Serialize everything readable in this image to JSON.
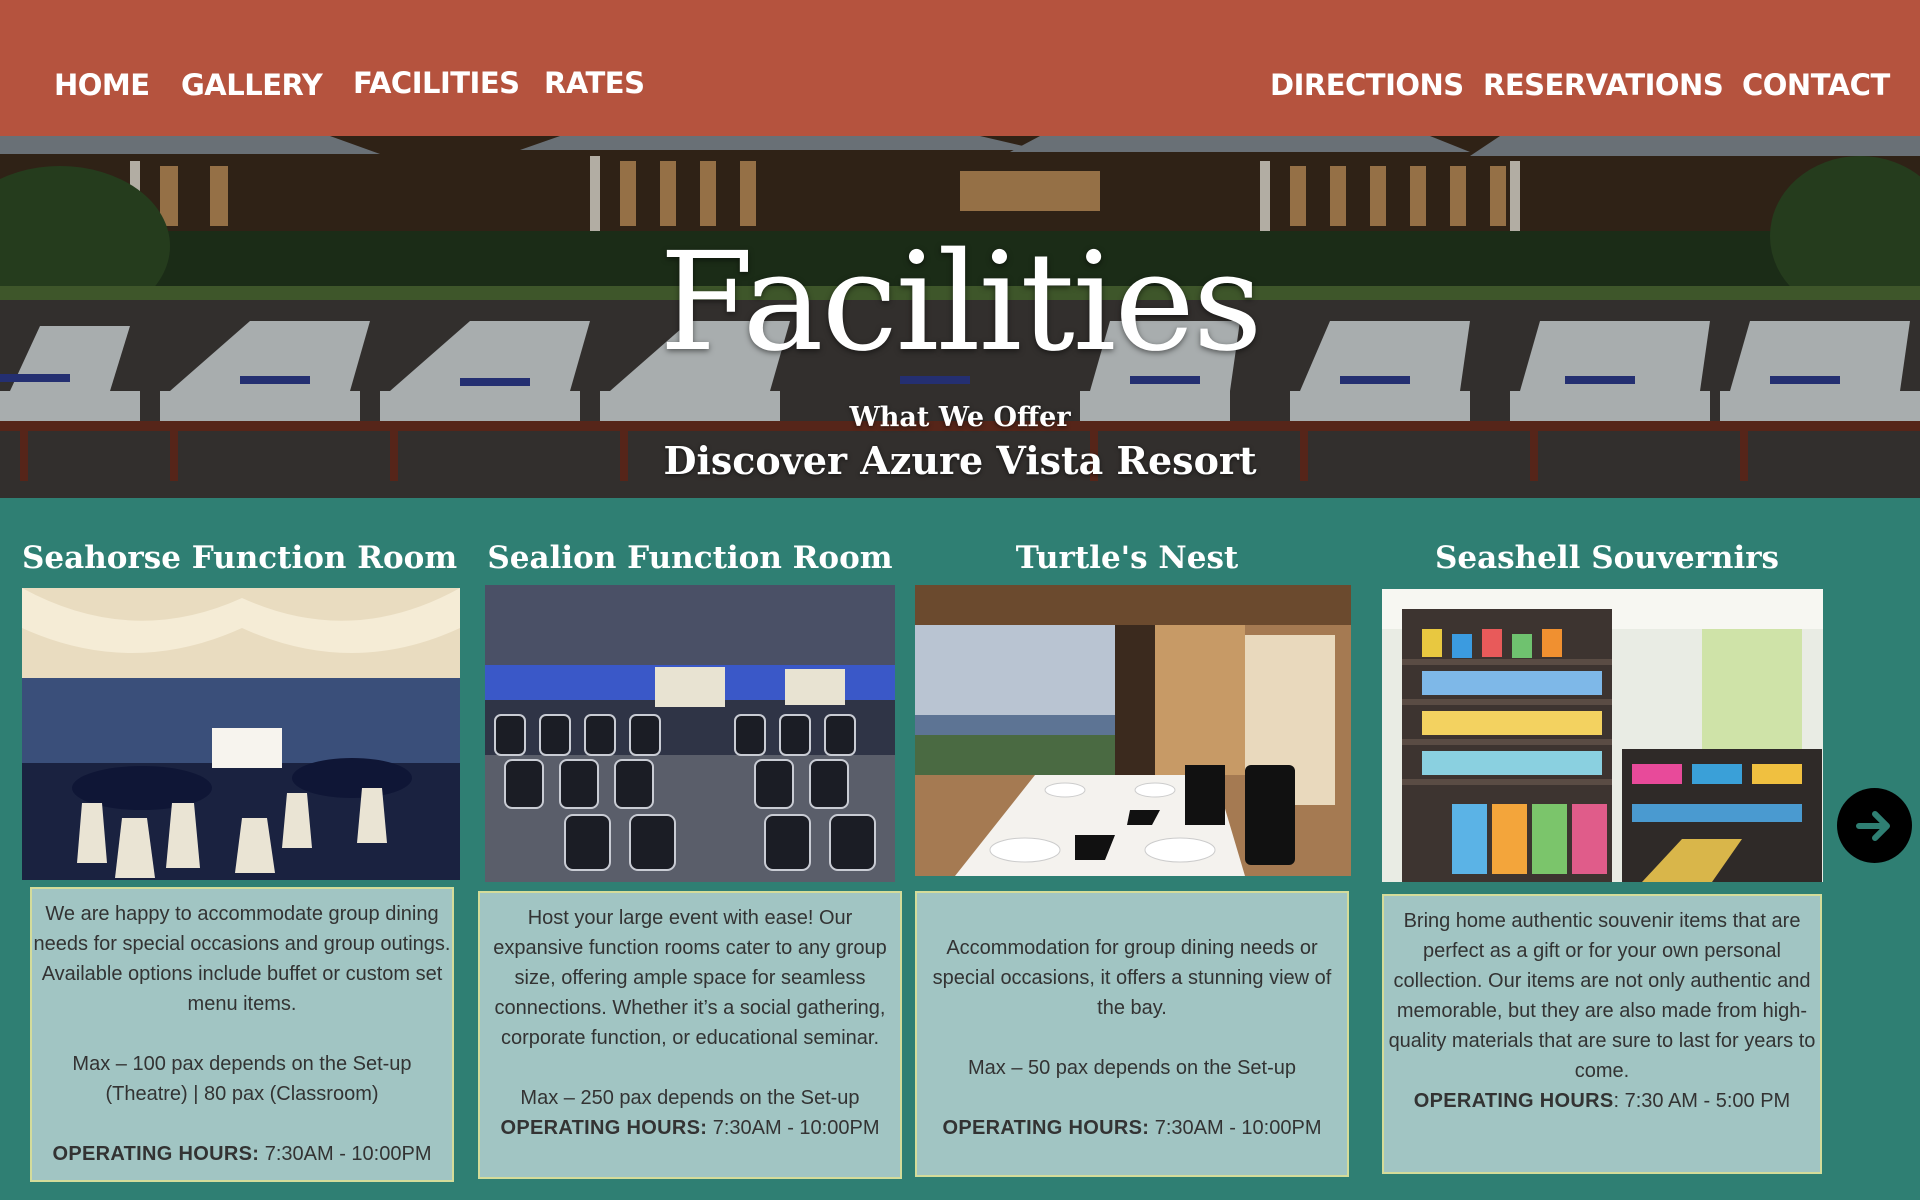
{
  "nav": {
    "left": [
      "HOME",
      "GALLERY",
      "FACILITIES",
      "RATES"
    ],
    "right": [
      "DIRECTIONS",
      "RESERVATIONS",
      "CONTACT"
    ]
  },
  "hero": {
    "title": "Facilities",
    "subtitle": "What We Offer",
    "tagline": "Discover Azure Vista Resort"
  },
  "cards": [
    {
      "title": "Seahorse Function Room",
      "desc1": "We are happy to accommodate group dining needs for special occasions and group outings. Available options include buffet or custom set menu items.",
      "desc2": "Max – 100 pax depends on the Set-up (Theatre) | 80 pax (Classroom)",
      "hours_label": "OPERATING HOURS:",
      "hours": " 7:30AM - 10:00PM"
    },
    {
      "title": "Sealion Function Room",
      "desc1": "Host your large event with ease! Our expansive function rooms cater to any group size, offering ample space for seamless connections. Whether it’s a social gathering, corporate function, or educational seminar.",
      "desc2": "Max – 250 pax depends on the Set-up",
      "hours_label": "OPERATING HOURS:",
      "hours": " 7:30AM - 10:00PM"
    },
    {
      "title": "Turtle's Nest",
      "desc1": "Accommodation for group dining needs or special occasions, it offers a stunning view of the bay.",
      "desc2": "Max – 50 pax depends on the Set-up",
      "hours_label": "OPERATING HOURS:",
      "hours": " 7:30AM - 10:00PM"
    },
    {
      "title": "Seashell Souvernirs",
      "desc1": "Bring home authentic souvenir items that are perfect as a gift or for your own personal collection. Our items are not only authentic and memorable, but they are also made from high-quality materials that are sure to last for years to come.",
      "hours_label": "OPERATING HOURS",
      "hours": ": 7:30 AM - 5:00 PM"
    }
  ],
  "icons": {
    "next": "arrow-right-circle-icon"
  },
  "colors": {
    "nav_bg": "#b5533e",
    "page_bg": "#2f7f73",
    "card_desc_bg": "#a1c5c3"
  }
}
